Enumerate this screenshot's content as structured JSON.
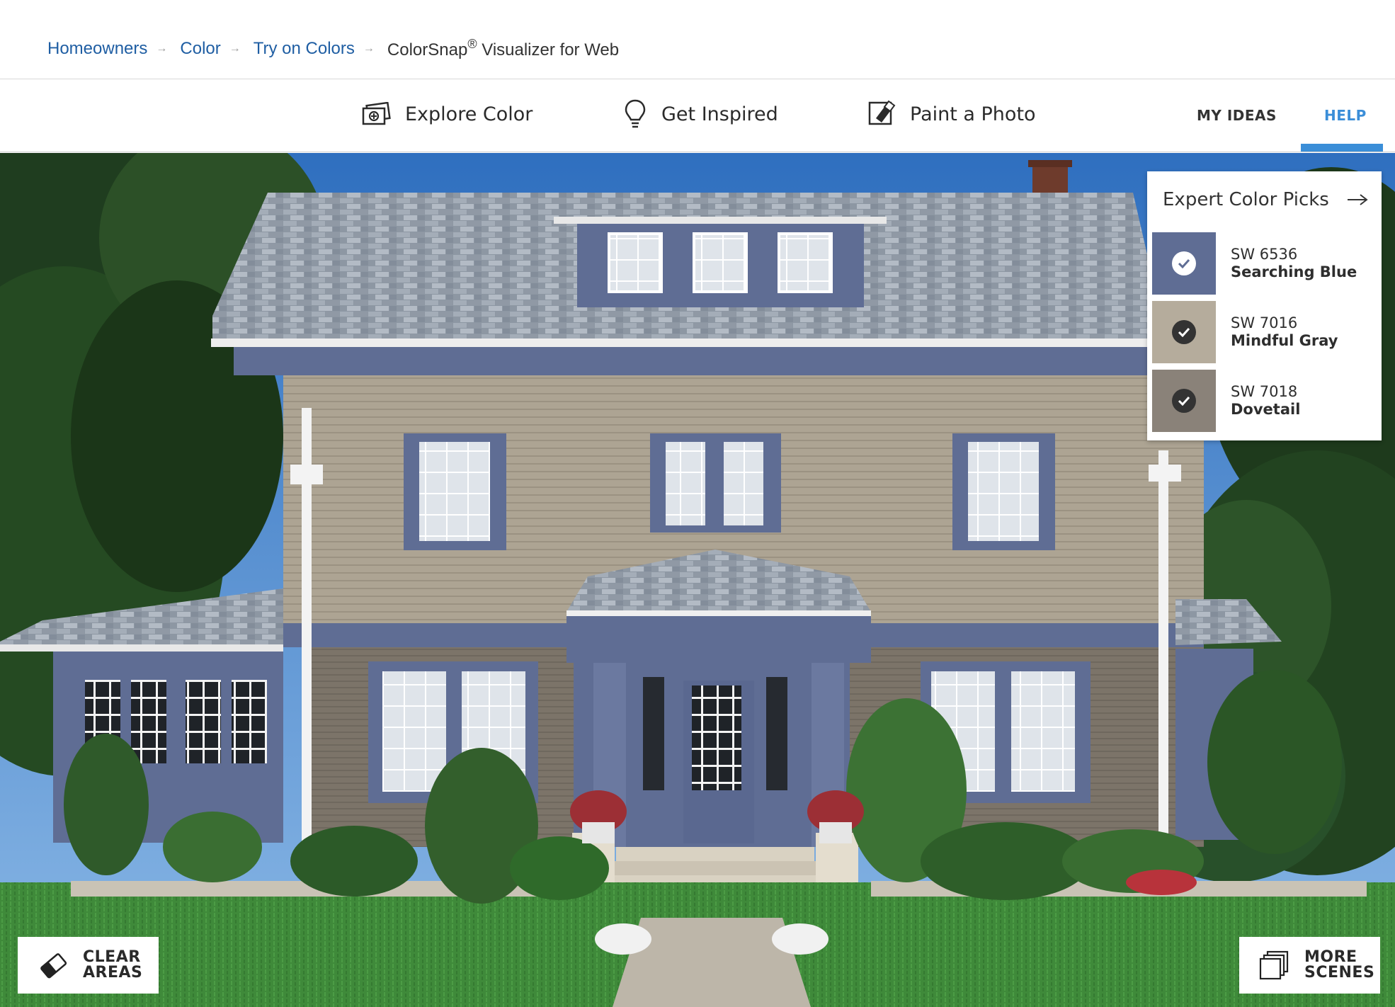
{
  "breadcrumb": {
    "items": [
      "Homeowners",
      "Color",
      "Try on Colors"
    ],
    "current": "ColorSnap",
    "current_mark": "®",
    "current_suffix": " Visualizer for Web",
    "separator": "→"
  },
  "nav": {
    "explore": "Explore Color",
    "inspired": "Get Inspired",
    "paint": "Paint a Photo",
    "my_ideas": "MY IDEAS",
    "help": "HELP"
  },
  "expert_picks": {
    "title": "Expert Color Picks",
    "colors": [
      {
        "code": "SW 6536",
        "name": "Searching Blue",
        "hex": "#5f6d94",
        "check_color": "#ffffff",
        "selected": true
      },
      {
        "code": "SW 7016",
        "name": "Mindful Gray",
        "hex": "#b5ac9c",
        "check_color": "#333333",
        "selected": false
      },
      {
        "code": "SW 7018",
        "name": "Dovetail",
        "hex": "#8a8279",
        "check_color": "#333333",
        "selected": false
      }
    ]
  },
  "buttons": {
    "clear_line1": "CLEAR",
    "clear_line2": "AREAS",
    "more_line1": "MORE",
    "more_line2": "SCENES"
  },
  "colors": {
    "link_blue": "#1f5ea3",
    "accent_blue": "#3b8ed8"
  }
}
